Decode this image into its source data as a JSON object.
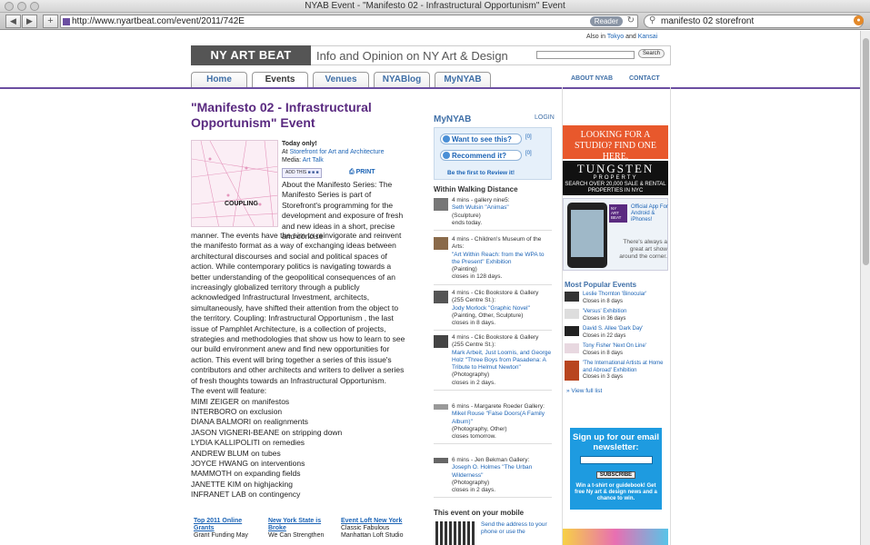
{
  "window": {
    "title": "NYAB Event - \"Manifesto 02 - Infrastructural Opportunism\" Event"
  },
  "browser": {
    "back": "◀",
    "forward": "▶",
    "add_tab": "+",
    "url": "http://www.nyartbeat.com/event/2011/742E",
    "reader_label": "Reader",
    "search_query": "manifesto 02 storefront"
  },
  "site": {
    "also_in": "Also in",
    "tokyo": "Tokyo",
    "and": "and",
    "kansai": "Kansai",
    "logo": "NY ART BEAT",
    "tagline": "Info and Opinion on NY Art & Design",
    "search_button": "Search",
    "tabs": [
      "Home",
      "Events",
      "Venues",
      "NYABlog",
      "MyNYAB"
    ],
    "about": "ABOUT NYAB",
    "contact": "CONTACT"
  },
  "event": {
    "title": "\"Manifesto 02 - Infrastructural Opportunism\" Event",
    "poster_title": "COUPLING",
    "today": "Today only!",
    "at_label": "At",
    "venue": "Storefront for Art and Architecture",
    "media_label": "Media:",
    "media": "Art Talk",
    "add_this": "ADD THIS",
    "print": "PRINT",
    "description_top": "About the Manifesto Series: The Manifesto Series is part of Storefront's programming for the development and exposure of fresh and new ideas in a short, precise and concise",
    "description_rest": "manner. The events have the aim to reinvigorate and reinvent the manifesto format as a way of exchanging ideas between architectural discourses and social and political spaces of action. While contemporary politics is navigating towards a better understanding of the geopolitical consequences of an increasingly globalized territory through a publicly acknowledged Infrastructural Investment, architects, simultaneously, have shifted their attention from the object to the territory. Coupling: Infrastructural Opportunism , the last issue of Pamphlet Architecture, is a collection of projects, strategies and methodologies that show us how to learn to see our build environment anew and find new opportunities for action. This event will bring together a series of this issue's contributors and other architects and writers to deliver a series of fresh thoughts towards an Infrastructural Opportunism.",
    "feature_intro": "The event will feature:",
    "speakers": [
      "MIMI ZEIGER on manifestos",
      "INTERBORO on exclusion",
      "DIANA BALMORI on realignments",
      "JASON VIGNERI-BEANE on stripping down",
      "LYDIA KALLIPOLITI on remedies",
      "ANDREW BLUM on tubes",
      "JOYCE HWANG on interventions",
      "MAMMOTH on expanding fields",
      "JANETTE KIM on highjacking",
      "INFRANET LAB on contingency"
    ]
  },
  "bottom_links": [
    {
      "title": "Top 2011 Online Grants",
      "text": "Grant Funding May"
    },
    {
      "title": "New York State is Broke",
      "text": "We Can Strengthen"
    },
    {
      "title": "Event Loft New York",
      "text": "Classic Fabulous Manhattan Loft Studio"
    }
  ],
  "mynyab": {
    "heading": "MyNYAB",
    "login": "LOGIN",
    "want": "Want to see this?",
    "want_count": "[0]",
    "recommend": "Recommend it?",
    "recommend_count": "[0]",
    "review": "Be the first to Review it!"
  },
  "walking": {
    "heading": "Within Walking Distance",
    "items": [
      {
        "meta": "4 mins - gallery nine5:",
        "title": "Seth Wulsin \"Animas\"",
        "type": "(Sculpture)",
        "closes": "ends today."
      },
      {
        "meta": "4 mins - Children's Museum of the Arts:",
        "title": "\"Art Within Reach: from the WPA to the Present\" Exhibition",
        "type": "(Painting)",
        "closes": "closes in 128 days."
      },
      {
        "meta": "4 mins - Clic Bookstore & Gallery (255 Centre St.):",
        "title": "Jody Morlock \"Graphic Novel\"",
        "type": "(Painting, Other, Sculpture)",
        "closes": "closes in 8 days."
      },
      {
        "meta": "4 mins - Clic Bookstore & Gallery (255 Centre St.):",
        "title": "Mark Arbeit, Just Loomis, and George Holz \"Three Boys from Pasadena: A Tribute to Helmut Newton\"",
        "type": "(Photography)",
        "closes": "closes in 2 days."
      },
      {
        "meta": "6 mins - Margarete Roeder Gallery:",
        "title": "Mikel Rouse \"False Doors(A Family Album)\"",
        "type": "(Photography, Other)",
        "closes": "closes tomorrow."
      },
      {
        "meta": "6 mins - Jen Bekman Gallery:",
        "title": "Joseph O. Holmes \"The Urban Wilderness\"",
        "type": "(Photography)",
        "closes": "closes in 2 days."
      }
    ]
  },
  "mobile": {
    "heading": "This event on your mobile",
    "text": "Send the address to your phone or use the"
  },
  "ads": {
    "studio": "LOOKING FOR A STUDIO? FIND ONE HERE.",
    "tungsten": "TUNGSTEN",
    "property": "PROPERTY",
    "tungsten_sub": "SEARCH OVER 20,000 SALE & RENTAL PROPERTIES IN NYC",
    "app_logo": "NY ART BEAT",
    "app_text": "Official App For Android & iPhones!",
    "app_tagline": "There's always a great art show around the corner."
  },
  "popular": {
    "heading": "Most Popular Events",
    "items": [
      {
        "title": "Leslie Thornton 'Binocular'",
        "closes": "Closes in 8 days"
      },
      {
        "title": "'Versus' Exhibition",
        "closes": "Closes in 36 days"
      },
      {
        "title": "David S. Allee 'Dark Day'",
        "closes": "Closes in 22 days"
      },
      {
        "title": "Tony Fisher 'Next On Line'",
        "closes": "Closes in 8 days"
      },
      {
        "title": "'The International Artists at Home and Abroad' Exhibition",
        "closes": "Closes in 3 days"
      }
    ],
    "view_all": "» View full list"
  },
  "newsletter": {
    "heading": "Sign up for our email newsletter:",
    "button": "SUBSCRIBE",
    "footer": "Win a t-shirt or guidebook! Get free Ny art & design news and a chance to win."
  }
}
